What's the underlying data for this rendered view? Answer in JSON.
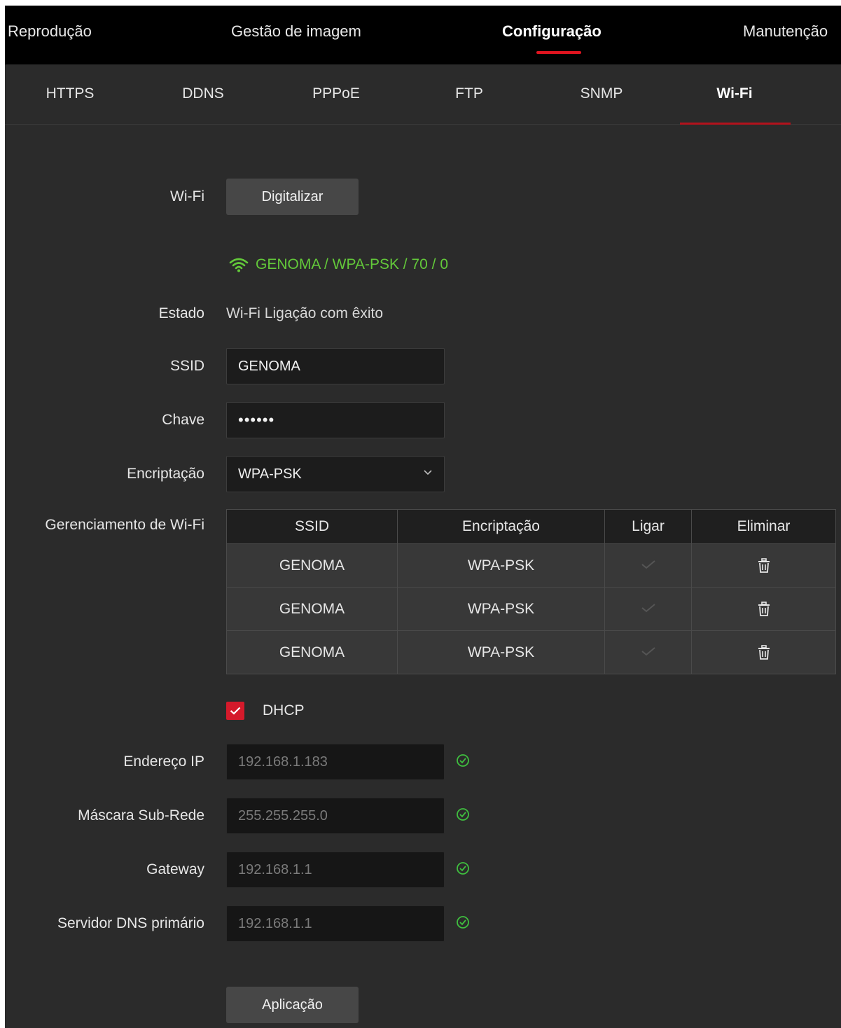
{
  "top_nav": {
    "tabs": [
      {
        "label": "Reprodução"
      },
      {
        "label": "Gestão de imagem"
      },
      {
        "label": "Configuração",
        "active": true
      },
      {
        "label": "Manutenção"
      }
    ]
  },
  "sub_nav": {
    "tabs": [
      {
        "label": "HTTPS"
      },
      {
        "label": "DDNS"
      },
      {
        "label": "PPPoE"
      },
      {
        "label": "FTP"
      },
      {
        "label": "SNMP"
      },
      {
        "label": "Wi-Fi",
        "active": true
      }
    ]
  },
  "form": {
    "wifi_label": "Wi-Fi",
    "scan_button": "Digitalizar",
    "connected_network": "GENOMA / WPA-PSK / 70 / 0",
    "state_label": "Estado",
    "state_value": "Wi-Fi Ligação com êxito",
    "ssid_label": "SSID",
    "ssid_value": "GENOMA",
    "key_label": "Chave",
    "key_value": "••••••",
    "encryption_label": "Encriptação",
    "encryption_value": "WPA-PSK",
    "management_label": "Gerenciamento de Wi-Fi",
    "dhcp_label": "DHCP",
    "dhcp_checked": true,
    "ip_label": "Endereço IP",
    "ip_value": "192.168.1.183",
    "mask_label": "Máscara Sub-Rede",
    "mask_value": "255.255.255.0",
    "gateway_label": "Gateway",
    "gateway_value": "192.168.1.1",
    "dns_label": "Servidor DNS primário",
    "dns_value": "192.168.1.1",
    "apply_button": "Aplicação"
  },
  "wifi_table": {
    "columns": [
      "SSID",
      "Encriptação",
      "Ligar",
      "Eliminar"
    ],
    "rows": [
      {
        "ssid": "GENOMA",
        "encryption": "WPA-PSK"
      },
      {
        "ssid": "GENOMA",
        "encryption": "WPA-PSK"
      },
      {
        "ssid": "GENOMA",
        "encryption": "WPA-PSK"
      }
    ]
  },
  "colors": {
    "accent_red": "#e0141f",
    "success_green": "#63c93a",
    "background": "#2b2b2b",
    "nav_background": "#000000"
  },
  "icons": {
    "wifi": "wifi-signal-icon",
    "delete": "trash-icon",
    "connect": "checkmark-icon",
    "valid": "check-circle-icon",
    "dropdown": "chevron-down-icon"
  }
}
